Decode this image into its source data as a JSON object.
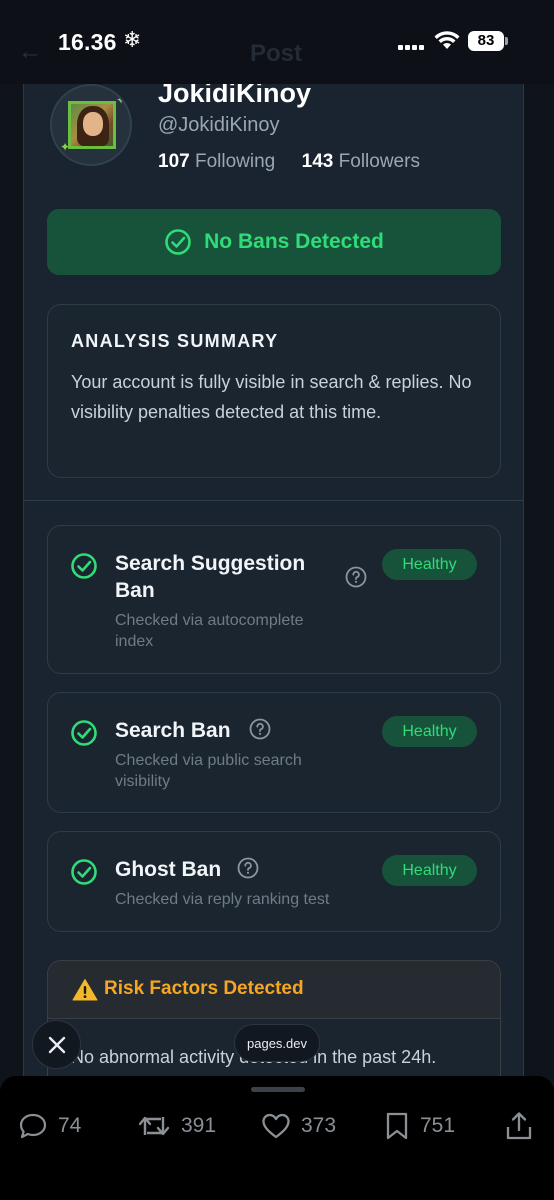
{
  "status_bar": {
    "time": "16.36",
    "battery": "83",
    "header_title": "Post"
  },
  "profile": {
    "display_name": "JokidiKinoy",
    "handle": "@JokidiKinoy",
    "following_count": "107",
    "following_label": "Following",
    "followers_count": "143",
    "followers_label": "Followers"
  },
  "result_banner": "No Bans Detected",
  "summary": {
    "title": "ANALYSIS SUMMARY",
    "text": "Your account is fully visible in search & replies. No visibility penalties detected at this time."
  },
  "checks": [
    {
      "title_line1": "Search Suggestion",
      "title_line2": "Ban",
      "sub_line1": "Checked via autocomplete",
      "sub_line2": "index",
      "status": "Healthy"
    },
    {
      "title_line1": "Search Ban",
      "sub_line1": "Checked via public search",
      "sub_line2": "visibility",
      "status": "Healthy"
    },
    {
      "title_line1": "Ghost Ban",
      "sub_line1": "Checked via reply ranking test",
      "status": "Healthy"
    }
  ],
  "risk": {
    "title": "Risk Factors Detected",
    "body": "No abnormal activity detected in the past 24h."
  },
  "browser": {
    "domain": "pages.dev"
  },
  "actions": {
    "replies": "74",
    "reposts": "391",
    "likes": "373",
    "bookmarks": "751"
  },
  "colors": {
    "accent_green": "#2fdc78",
    "badge_bg": "#17533a",
    "warning": "#f5a623"
  }
}
